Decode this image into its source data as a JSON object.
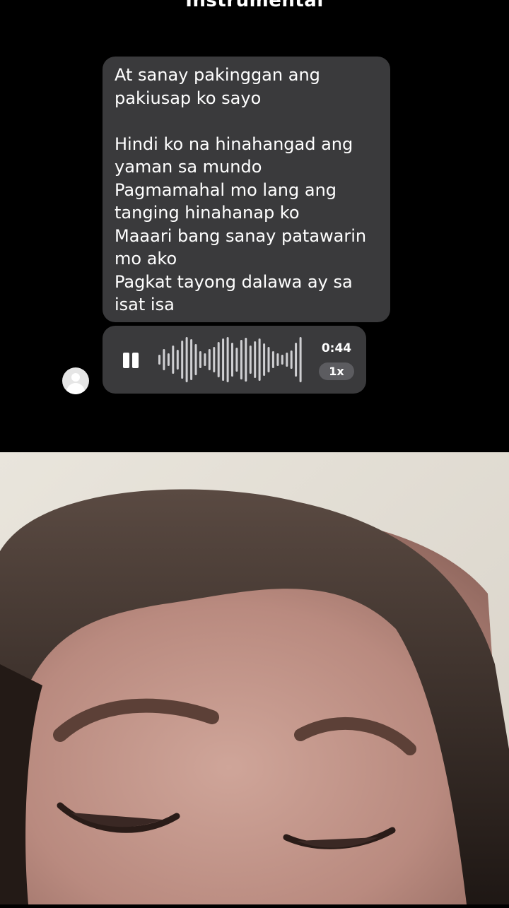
{
  "header": {
    "title": "Instrumental"
  },
  "message": {
    "lines": [
      "At sanay pakinggan ang",
      "pakiusap ko sayo",
      "",
      "Hindi ko na hinahangad ang",
      "yaman sa mundo",
      "Pagmamahal mo lang ang",
      "tanging hinahanap ko",
      "Maaari bang sanay patawarin",
      "mo ako",
      "Pagkat tayong dalawa ay sa",
      "isat isa"
    ]
  },
  "voice_message": {
    "state_icon": "pause-icon",
    "duration": "0:44",
    "speed": "1x"
  },
  "avatar": {
    "icon": "default-user-avatar-icon"
  },
  "camera": {
    "description_icon": "front-camera-feed"
  },
  "colors": {
    "background": "#000000",
    "bubble": "#3a3a3c",
    "pill": "#5c5c60",
    "text": "#ffffff"
  }
}
